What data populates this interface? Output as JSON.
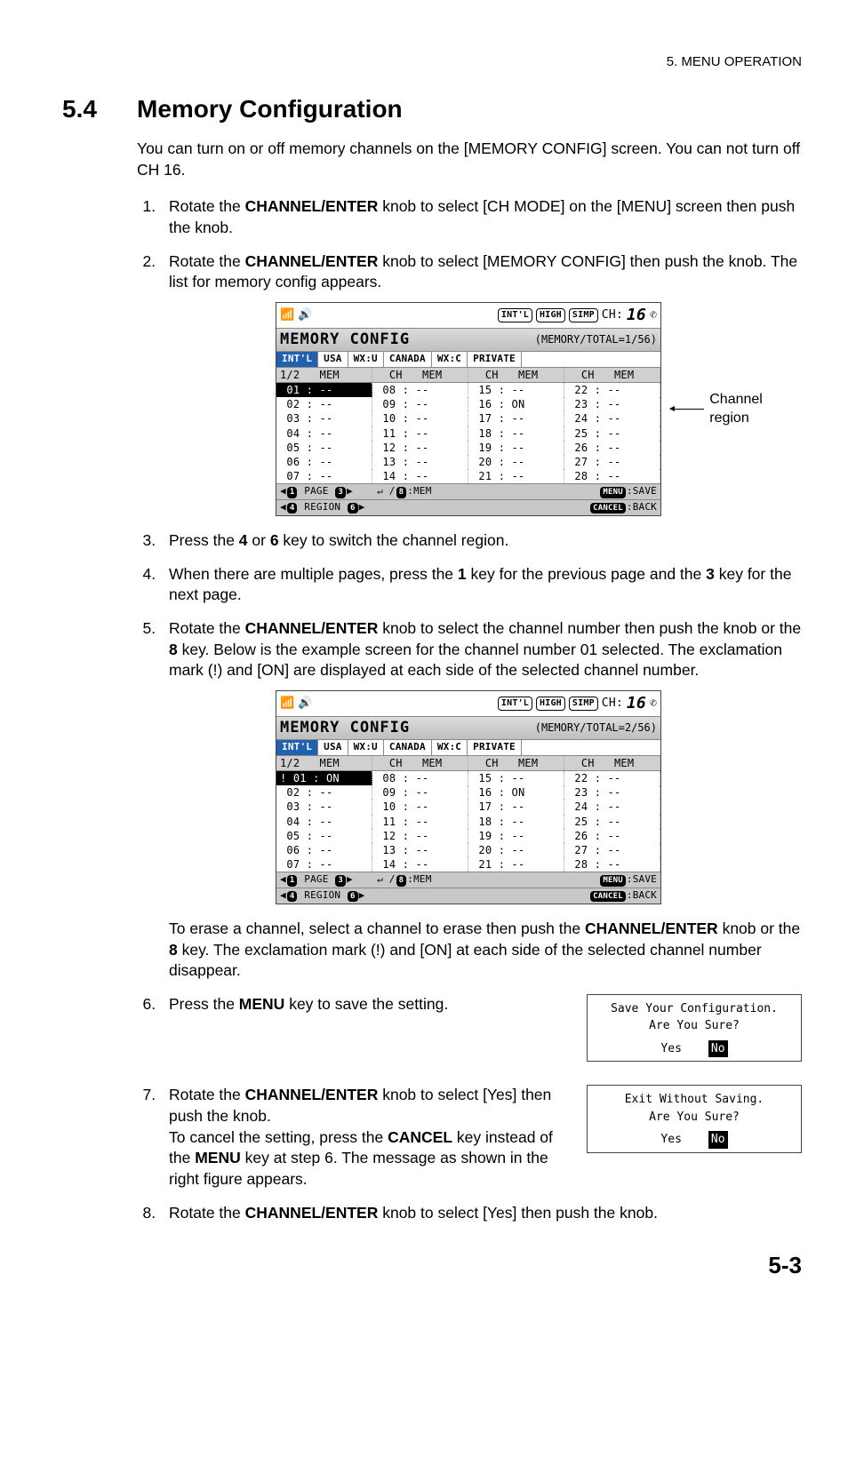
{
  "header": "5.  MENU OPERATION",
  "section_num": "5.4",
  "section_title": "Memory Configuration",
  "intro": "You can turn on or off memory channels on the [MEMORY CONFIG] screen. You can not turn off CH 16.",
  "steps": {
    "s1a": "Rotate the ",
    "s1b": "CHANNEL/ENTER",
    "s1c": " knob to select [CH MODE] on the [MENU] screen then push the knob.",
    "s2a": "Rotate the ",
    "s2b": "CHANNEL/ENTER",
    "s2c": " knob to select [MEMORY CONFIG] then push the knob. The list for memory config appears.",
    "s3a": "Press the ",
    "s3b": "4",
    "s3c": " or ",
    "s3d": "6",
    "s3e": " key to switch the channel region.",
    "s4a": "When there are multiple pages, press the ",
    "s4b": "1",
    "s4c": " key for the previous page and the ",
    "s4d": "3",
    "s4e": " key for the next page.",
    "s5a": "Rotate the ",
    "s5b": "CHANNEL/ENTER",
    "s5c": " knob to select the channel number then push the knob or the ",
    "s5d": "8",
    "s5e": " key. Below is the example screen for the channel number 01 selected. The exclamation mark (!) and [ON] are displayed at each side of the selected channel number.",
    "s5_post_a": "To erase a channel, select a channel to erase then push the ",
    "s5_post_b": "CHANNEL/ENTER",
    "s5_post_c": " knob or the ",
    "s5_post_d": "8",
    "s5_post_e": " key. The exclamation mark (!) and [ON] at each side of the selected channel number disappear.",
    "s6a": "Press the ",
    "s6b": "MENU",
    "s6c": " key to save the setting.",
    "s7a": "Rotate the ",
    "s7b": "CHANNEL/ENTER",
    "s7c": " knob to select [Yes] then push the knob.",
    "s7d": "To cancel the setting, press the ",
    "s7e": "CANCEL",
    "s7f": " key instead of the ",
    "s7g": "MENU",
    "s7h": " key at step 6. The message as shown in the right figure appears.",
    "s8a": "Rotate the ",
    "s8b": "CHANNEL/ENTER",
    "s8c": " knob to select [Yes] then push the knob."
  },
  "annot": "Channel region",
  "lcd_common": {
    "pill1": "INT'L",
    "pill2": "HIGH",
    "pill3": "SIMP",
    "ch_label": "CH:",
    "ch_num": "16",
    "title_main": "MEMORY CONFIG",
    "tabs": [
      "INT'L",
      "USA",
      "WX:U",
      "CANADA",
      "WX:C",
      "PRIVATE"
    ],
    "hdr": [
      "1/2   MEM",
      "  CH   MEM",
      "  CH   MEM",
      "  CH   MEM"
    ],
    "foot_page": "PAGE",
    "foot_region": "REGION",
    "foot_mem": ":MEM",
    "foot_save": ":SAVE",
    "foot_back": ":BACK",
    "menu_cap": "MENU",
    "cancel_cap": "CANCEL"
  },
  "lcd1": {
    "title_sub": "(MEMORY/TOTAL=1/56)",
    "rows": [
      [
        " 01 : --",
        " 08 : --",
        " 15 : --",
        " 22 : --"
      ],
      [
        " 02 : --",
        " 09 : --",
        " 16 : ON",
        " 23 : --"
      ],
      [
        " 03 : --",
        " 10 : --",
        " 17 : --",
        " 24 : --"
      ],
      [
        " 04 : --",
        " 11 : --",
        " 18 : --",
        " 25 : --"
      ],
      [
        " 05 : --",
        " 12 : --",
        " 19 : --",
        " 26 : --"
      ],
      [
        " 06 : --",
        " 13 : --",
        " 20 : --",
        " 27 : --"
      ],
      [
        " 07 : --",
        " 14 : --",
        " 21 : --",
        " 28 : --"
      ]
    ],
    "sel_row": 0,
    "sel_col": 0,
    "sel_text": " 01 : --"
  },
  "lcd2": {
    "title_sub": "(MEMORY/TOTAL=2/56)",
    "rows": [
      [
        "! 01 : ON",
        " 08 : --",
        " 15 : --",
        " 22 : --"
      ],
      [
        " 02 : --",
        " 09 : --",
        " 16 : ON",
        " 23 : --"
      ],
      [
        " 03 : --",
        " 10 : --",
        " 17 : --",
        " 24 : --"
      ],
      [
        " 04 : --",
        " 11 : --",
        " 18 : --",
        " 25 : --"
      ],
      [
        " 05 : --",
        " 12 : --",
        " 19 : --",
        " 26 : --"
      ],
      [
        " 06 : --",
        " 13 : --",
        " 20 : --",
        " 27 : --"
      ],
      [
        " 07 : --",
        " 14 : --",
        " 21 : --",
        " 28 : --"
      ]
    ],
    "sel_row": 0,
    "sel_col": 0,
    "sel_text": "! 01 : ON"
  },
  "dialog1": {
    "line1": "Save Your Configuration.",
    "line2": "Are You Sure?",
    "yes": "Yes",
    "no": "No"
  },
  "dialog2": {
    "line1": "Exit Without Saving.",
    "line2": "Are You Sure?",
    "yes": "Yes",
    "no": "No"
  },
  "page_num": "5-3"
}
